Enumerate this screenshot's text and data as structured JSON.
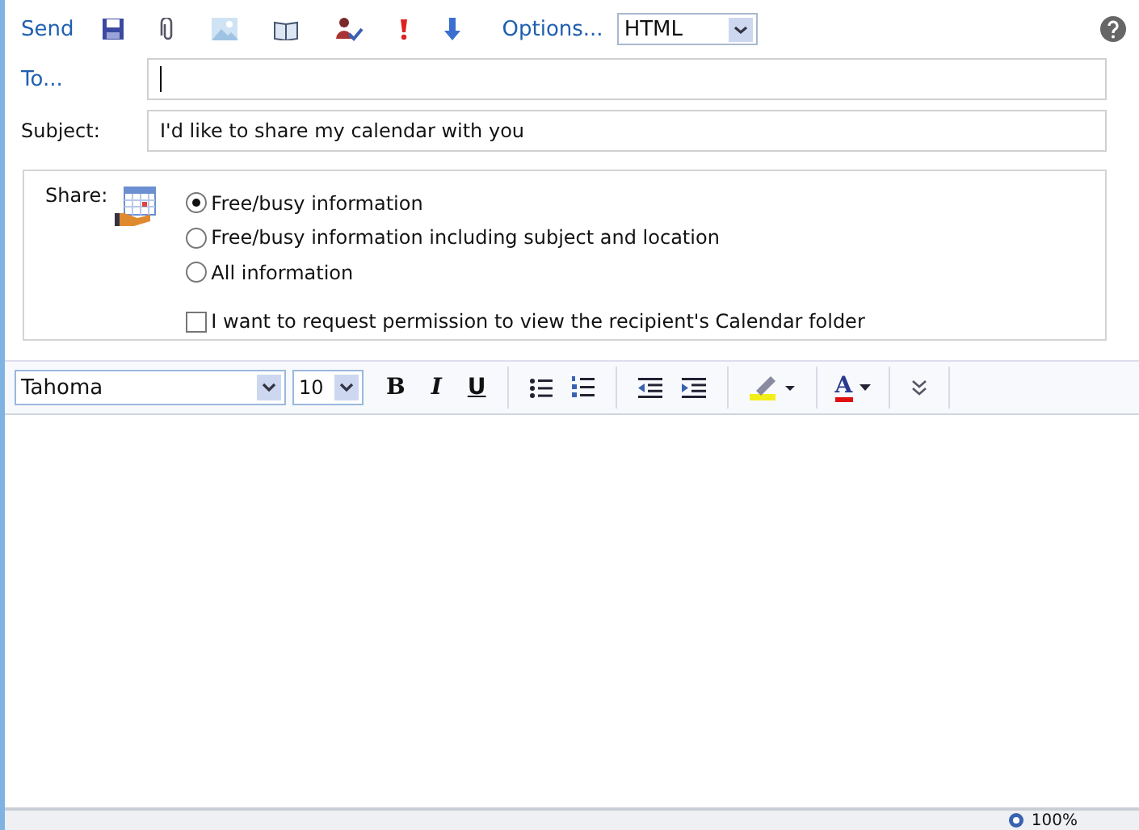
{
  "toolbar": {
    "send": "Send",
    "options": "Options...",
    "format": "HTML"
  },
  "to_button": "To...",
  "subject": {
    "label": "Subject:",
    "value": "I'd like to share my calendar with you"
  },
  "share": {
    "label": "Share:",
    "options": [
      {
        "label": "Free/busy information",
        "selected": true
      },
      {
        "label": "Free/busy information including subject and location",
        "selected": false
      },
      {
        "label": "All information",
        "selected": false
      }
    ],
    "permission": {
      "label": "I want to request permission to view the recipient's Calendar folder",
      "checked": false
    }
  },
  "format_bar": {
    "font": "Tahoma",
    "size": "10",
    "style_buttons": [
      {
        "kind": "bold",
        "glyph": "B"
      },
      {
        "kind": "italic",
        "glyph": "I"
      },
      {
        "kind": "underline",
        "glyph": "U"
      }
    ],
    "font_color_glyph": "A"
  },
  "status_bar": {
    "zoom": "100%"
  }
}
